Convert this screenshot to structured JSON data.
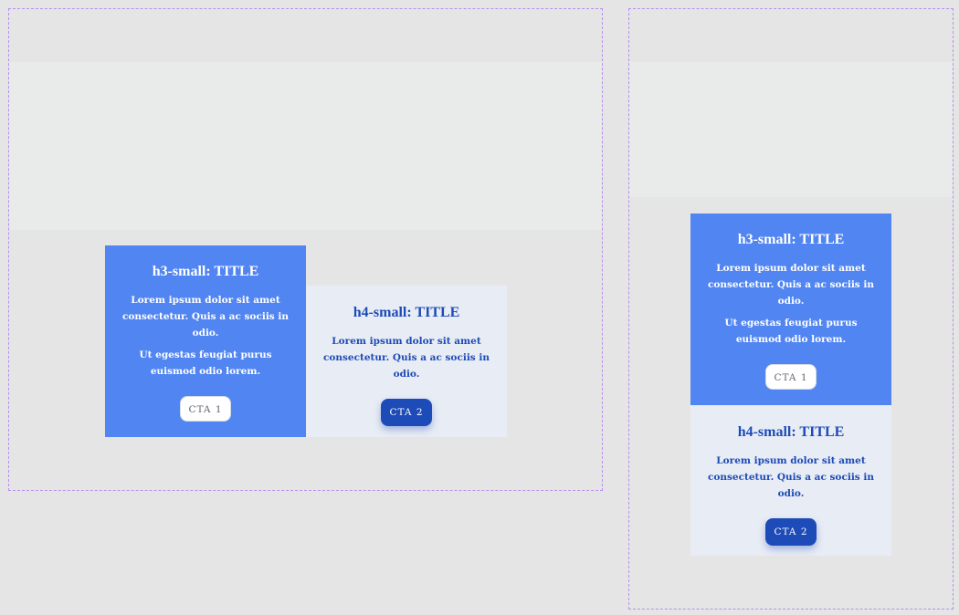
{
  "desktop": {
    "card_primary": {
      "title": "h3-small: TITLE",
      "text_1": "Lorem ipsum dolor sit amet consectetur. Quis a ac sociis in odio.",
      "text_2": "Ut egestas feugiat purus euismod odio lorem.",
      "cta_label": "CTA 1"
    },
    "card_secondary": {
      "title": "h4-small: TITLE",
      "text_1": "Lorem ipsum dolor sit amet consectetur. Quis a ac sociis in odio.",
      "cta_label": "CTA 2"
    }
  },
  "mobile": {
    "card_primary": {
      "title": "h3-small: TITLE",
      "text_1": "Lorem ipsum dolor sit amet consectetur. Quis a ac sociis in odio.",
      "text_2": "Ut egestas feugiat purus euismod odio lorem.",
      "cta_label": "CTA 1"
    },
    "card_secondary": {
      "title": "h4-small: TITLE",
      "text_1": "Lorem ipsum dolor sit amet consectetur. Quis a ac sociis in odio.",
      "cta_label": "CTA 2"
    }
  },
  "colors": {
    "primary": "#5185f1",
    "primary_dark": "#1d4bb7",
    "secondary_bg": "#e8ecf4",
    "frame_border": "#b98ef0",
    "canvas": "#e5e5e5"
  }
}
